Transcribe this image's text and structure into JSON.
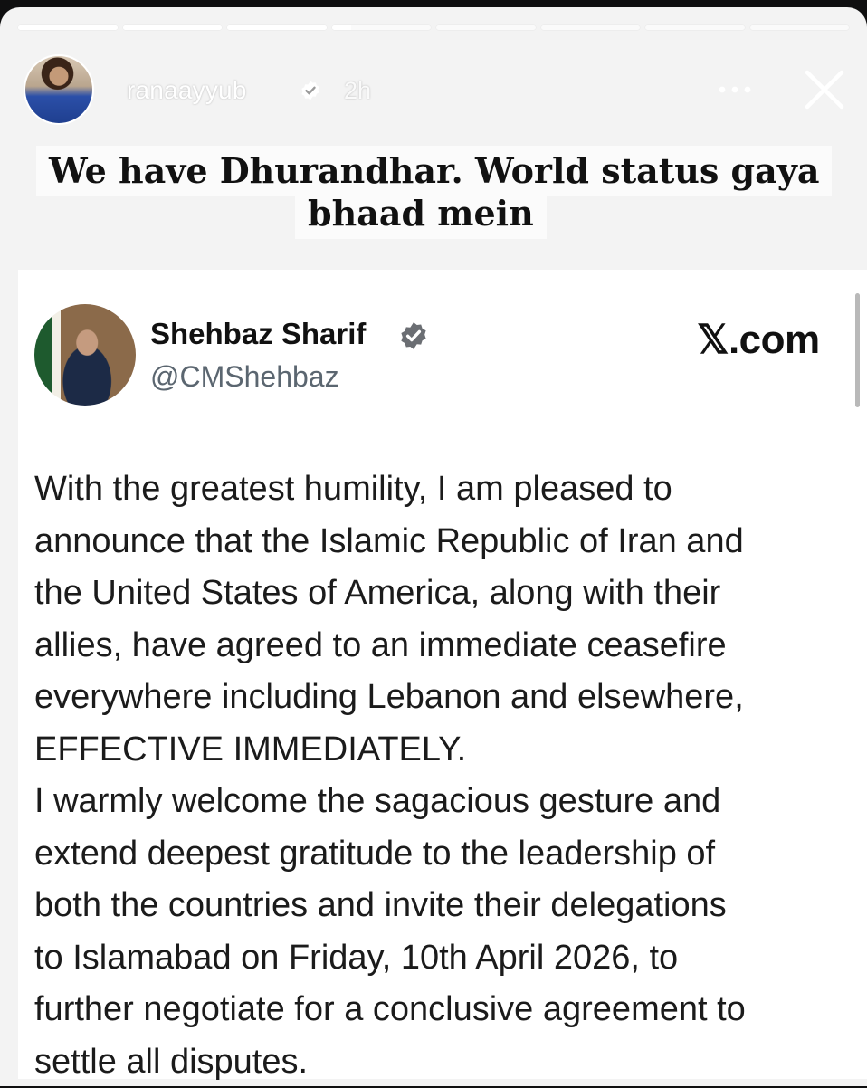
{
  "story": {
    "progress": [
      1,
      1,
      1,
      0.2,
      0,
      0,
      0,
      0
    ],
    "user": {
      "username": "ranaayyub",
      "time": "2h",
      "avatar_icon": "profile-photo"
    },
    "caption_lines": [
      "We have Dhurandhar. World status gaya",
      "bhaad mein"
    ]
  },
  "tweet": {
    "name": "Shehbaz Sharif",
    "handle": "@CMShehbaz",
    "source": "𝕏.com",
    "body_lines": [
      "With the greatest humility, I am pleased to",
      "announce that the Islamic Republic of Iran and",
      "the United States of America, along with their",
      "allies, have agreed to an immediate ceasefire",
      "everywhere including Lebanon and elsewhere,",
      "EFFECTIVE IMMEDIATELY.",
      "I warmly welcome the sagacious gesture and",
      "extend deepest gratitude to the leadership of",
      "both the countries and invite their delegations",
      "to Islamabad on Friday, 10th April 2026, to",
      "further negotiate for a conclusive agreement to",
      "settle all disputes."
    ]
  },
  "colors": {
    "verified_badge": "#6b6e73",
    "tweet_text": "#1b1b1b",
    "handle": "#5b6670"
  }
}
